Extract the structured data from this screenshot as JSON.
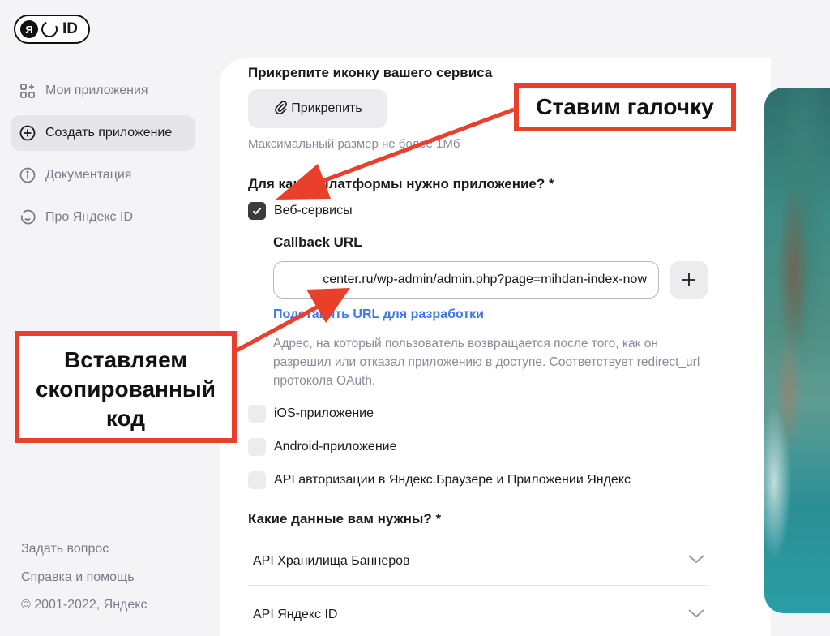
{
  "logo": {
    "ya": "Я",
    "id": "ID"
  },
  "nav": {
    "items": [
      {
        "label": "Мои приложения",
        "icon": "apps-grid-icon"
      },
      {
        "label": "Создать приложение",
        "icon": "plus-circle-icon"
      },
      {
        "label": "Документация",
        "icon": "info-circle-icon"
      },
      {
        "label": "Про Яндекс ID",
        "icon": "smile-icon"
      }
    ]
  },
  "footer": {
    "ask": "Задать вопрос",
    "help": "Справка и помощь",
    "copyright": "© 2001-2022, Яндекс"
  },
  "form": {
    "attach_title": "Прикрепите иконку вашего сервиса",
    "attach_button": "Прикрепить",
    "max_size": "Максимальный размер не более 1Мб",
    "platform_question": "Для какой платформы нужно приложение? *",
    "web_services": "Веб-сервисы",
    "callback_title": "Callback URL",
    "callback_value": "center.ru/wp-admin/admin.php?page=mihdan-index-now",
    "dev_link": "Подставить URL для разработки",
    "callback_help": "Адрес, на который пользователь возвращается после того, как он разрешил или отказал приложению в доступе. Соответствует redirect_url протокола OAuth.",
    "ios": "iOS-приложение",
    "android": "Android-приложение",
    "api_browser": "API авторизации в Яндекс.Браузере и Приложении Яндекс",
    "data_question": "Какие данные вам нужны? *",
    "accordions": [
      {
        "label": "API Хранилища Баннеров"
      },
      {
        "label": "API Яндекс ID"
      }
    ]
  },
  "annotations": {
    "check_note": "Ставим галочку",
    "paste_note_line1": "Вставляем",
    "paste_note_line2": "скопированный",
    "paste_note_line3": "код"
  },
  "colors": {
    "annotation_red": "#e8402a",
    "link_blue": "#3d77e8"
  }
}
